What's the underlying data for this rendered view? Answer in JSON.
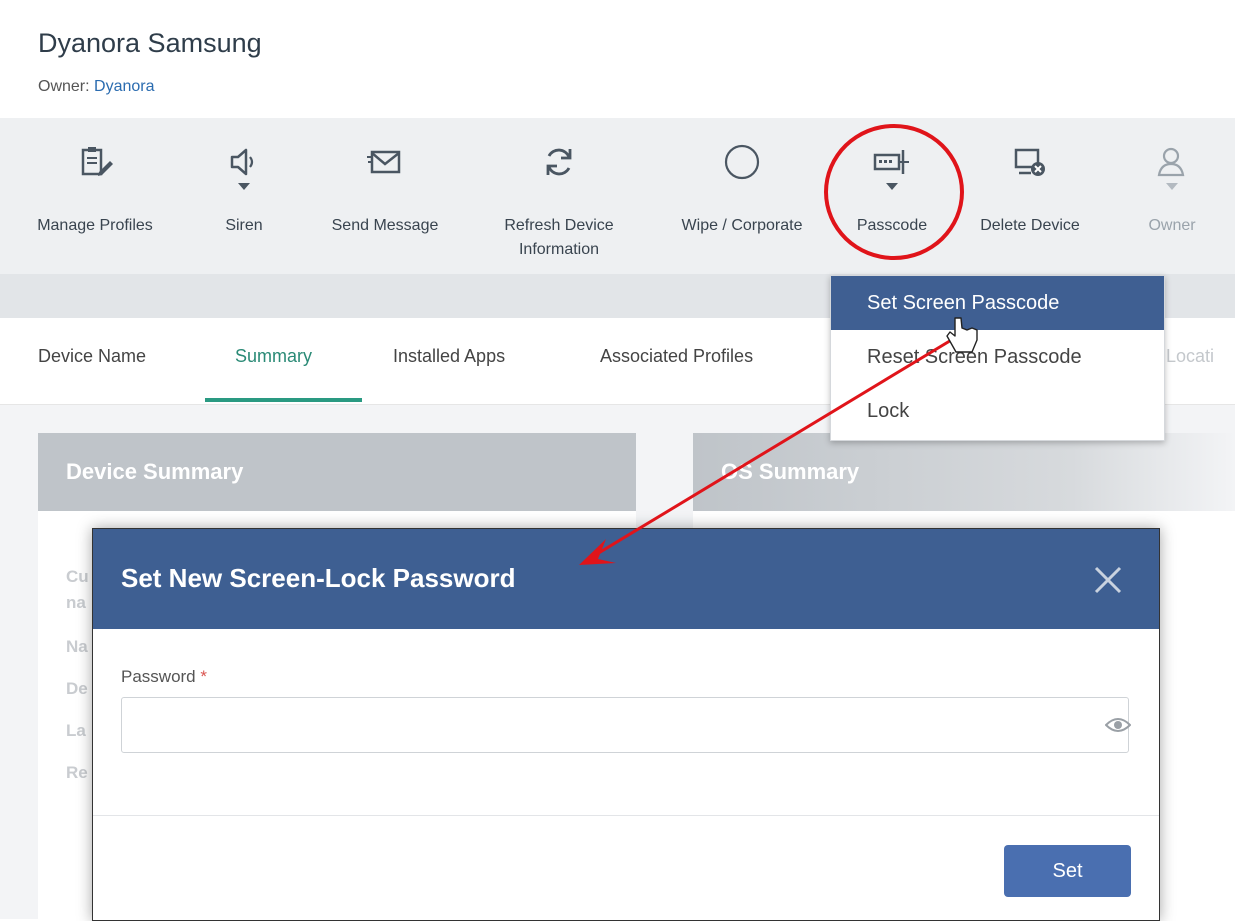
{
  "header": {
    "device_name": "Dyanora Samsung",
    "owner_label": "Owner:",
    "owner_name": "Dyanora"
  },
  "toolbar": {
    "items": [
      {
        "label": "Manage Profiles",
        "icon": "manage-profiles-icon"
      },
      {
        "label": "Siren",
        "icon": "speaker-icon"
      },
      {
        "label": "Send Message",
        "icon": "envelope-icon"
      },
      {
        "label": "Refresh Device",
        "label2": "Information",
        "icon": "refresh-icon"
      },
      {
        "label": "Wipe / Corporate",
        "icon": "circle-icon"
      },
      {
        "label": "Passcode",
        "icon": "passcode-icon"
      },
      {
        "label": "Delete Device",
        "icon": "delete-device-icon"
      },
      {
        "label": "Owner",
        "icon": "owner-icon"
      }
    ]
  },
  "tabs": [
    {
      "label": "Device Name"
    },
    {
      "label": "Summary",
      "active": true
    },
    {
      "label": "Installed Apps"
    },
    {
      "label": "Associated Profiles"
    },
    {
      "label": "Locati"
    }
  ],
  "passcode_menu": {
    "items": [
      {
        "label": "Set Screen Passcode",
        "active": true
      },
      {
        "label": "Reset Screen Passcode"
      },
      {
        "label": "Lock"
      }
    ]
  },
  "cards": {
    "device_summary": {
      "title": "Device Summary",
      "row_fragments": [
        "Cu",
        "na",
        "Na",
        "De",
        "La",
        "Re"
      ]
    },
    "os_summary": {
      "title": "OS Summary"
    }
  },
  "modal": {
    "title": "Set New Screen-Lock Password",
    "password_label": "Password",
    "required_mark": "*",
    "password_value": "",
    "set_label": "Set"
  },
  "colors": {
    "primary": "#3e5f92",
    "button": "#4a6fb0",
    "tab_active": "#2a9a82",
    "annotation": "#e0141a"
  }
}
